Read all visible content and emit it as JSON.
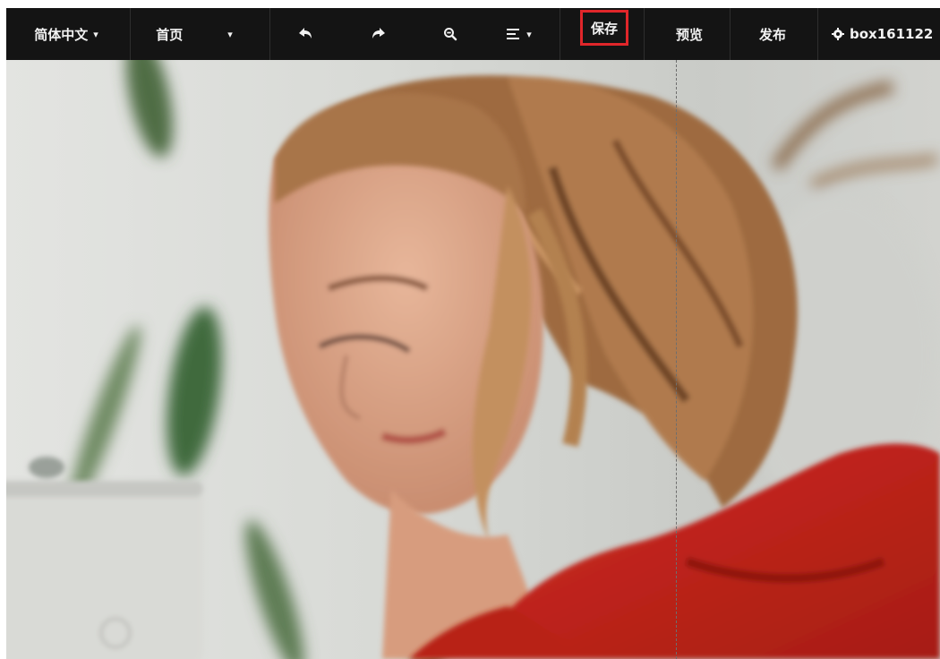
{
  "toolbar": {
    "language": "简体中文",
    "home": "首页",
    "save": "保存",
    "preview": "预览",
    "publish": "发布",
    "account": "box161122"
  },
  "icons": {
    "language_chevron": "chevron-down-icon",
    "home_chevron": "chevron-down-icon",
    "undo": "undo-icon",
    "redo": "redo-icon",
    "zoom": "zoom-out-icon",
    "align": "align-icon",
    "settings": "gear-icon"
  },
  "colors": {
    "toolbar_bg": "#141414",
    "highlight_border": "#e0262a",
    "shirt_red": "#c1261c",
    "hair": "#a8744a"
  }
}
